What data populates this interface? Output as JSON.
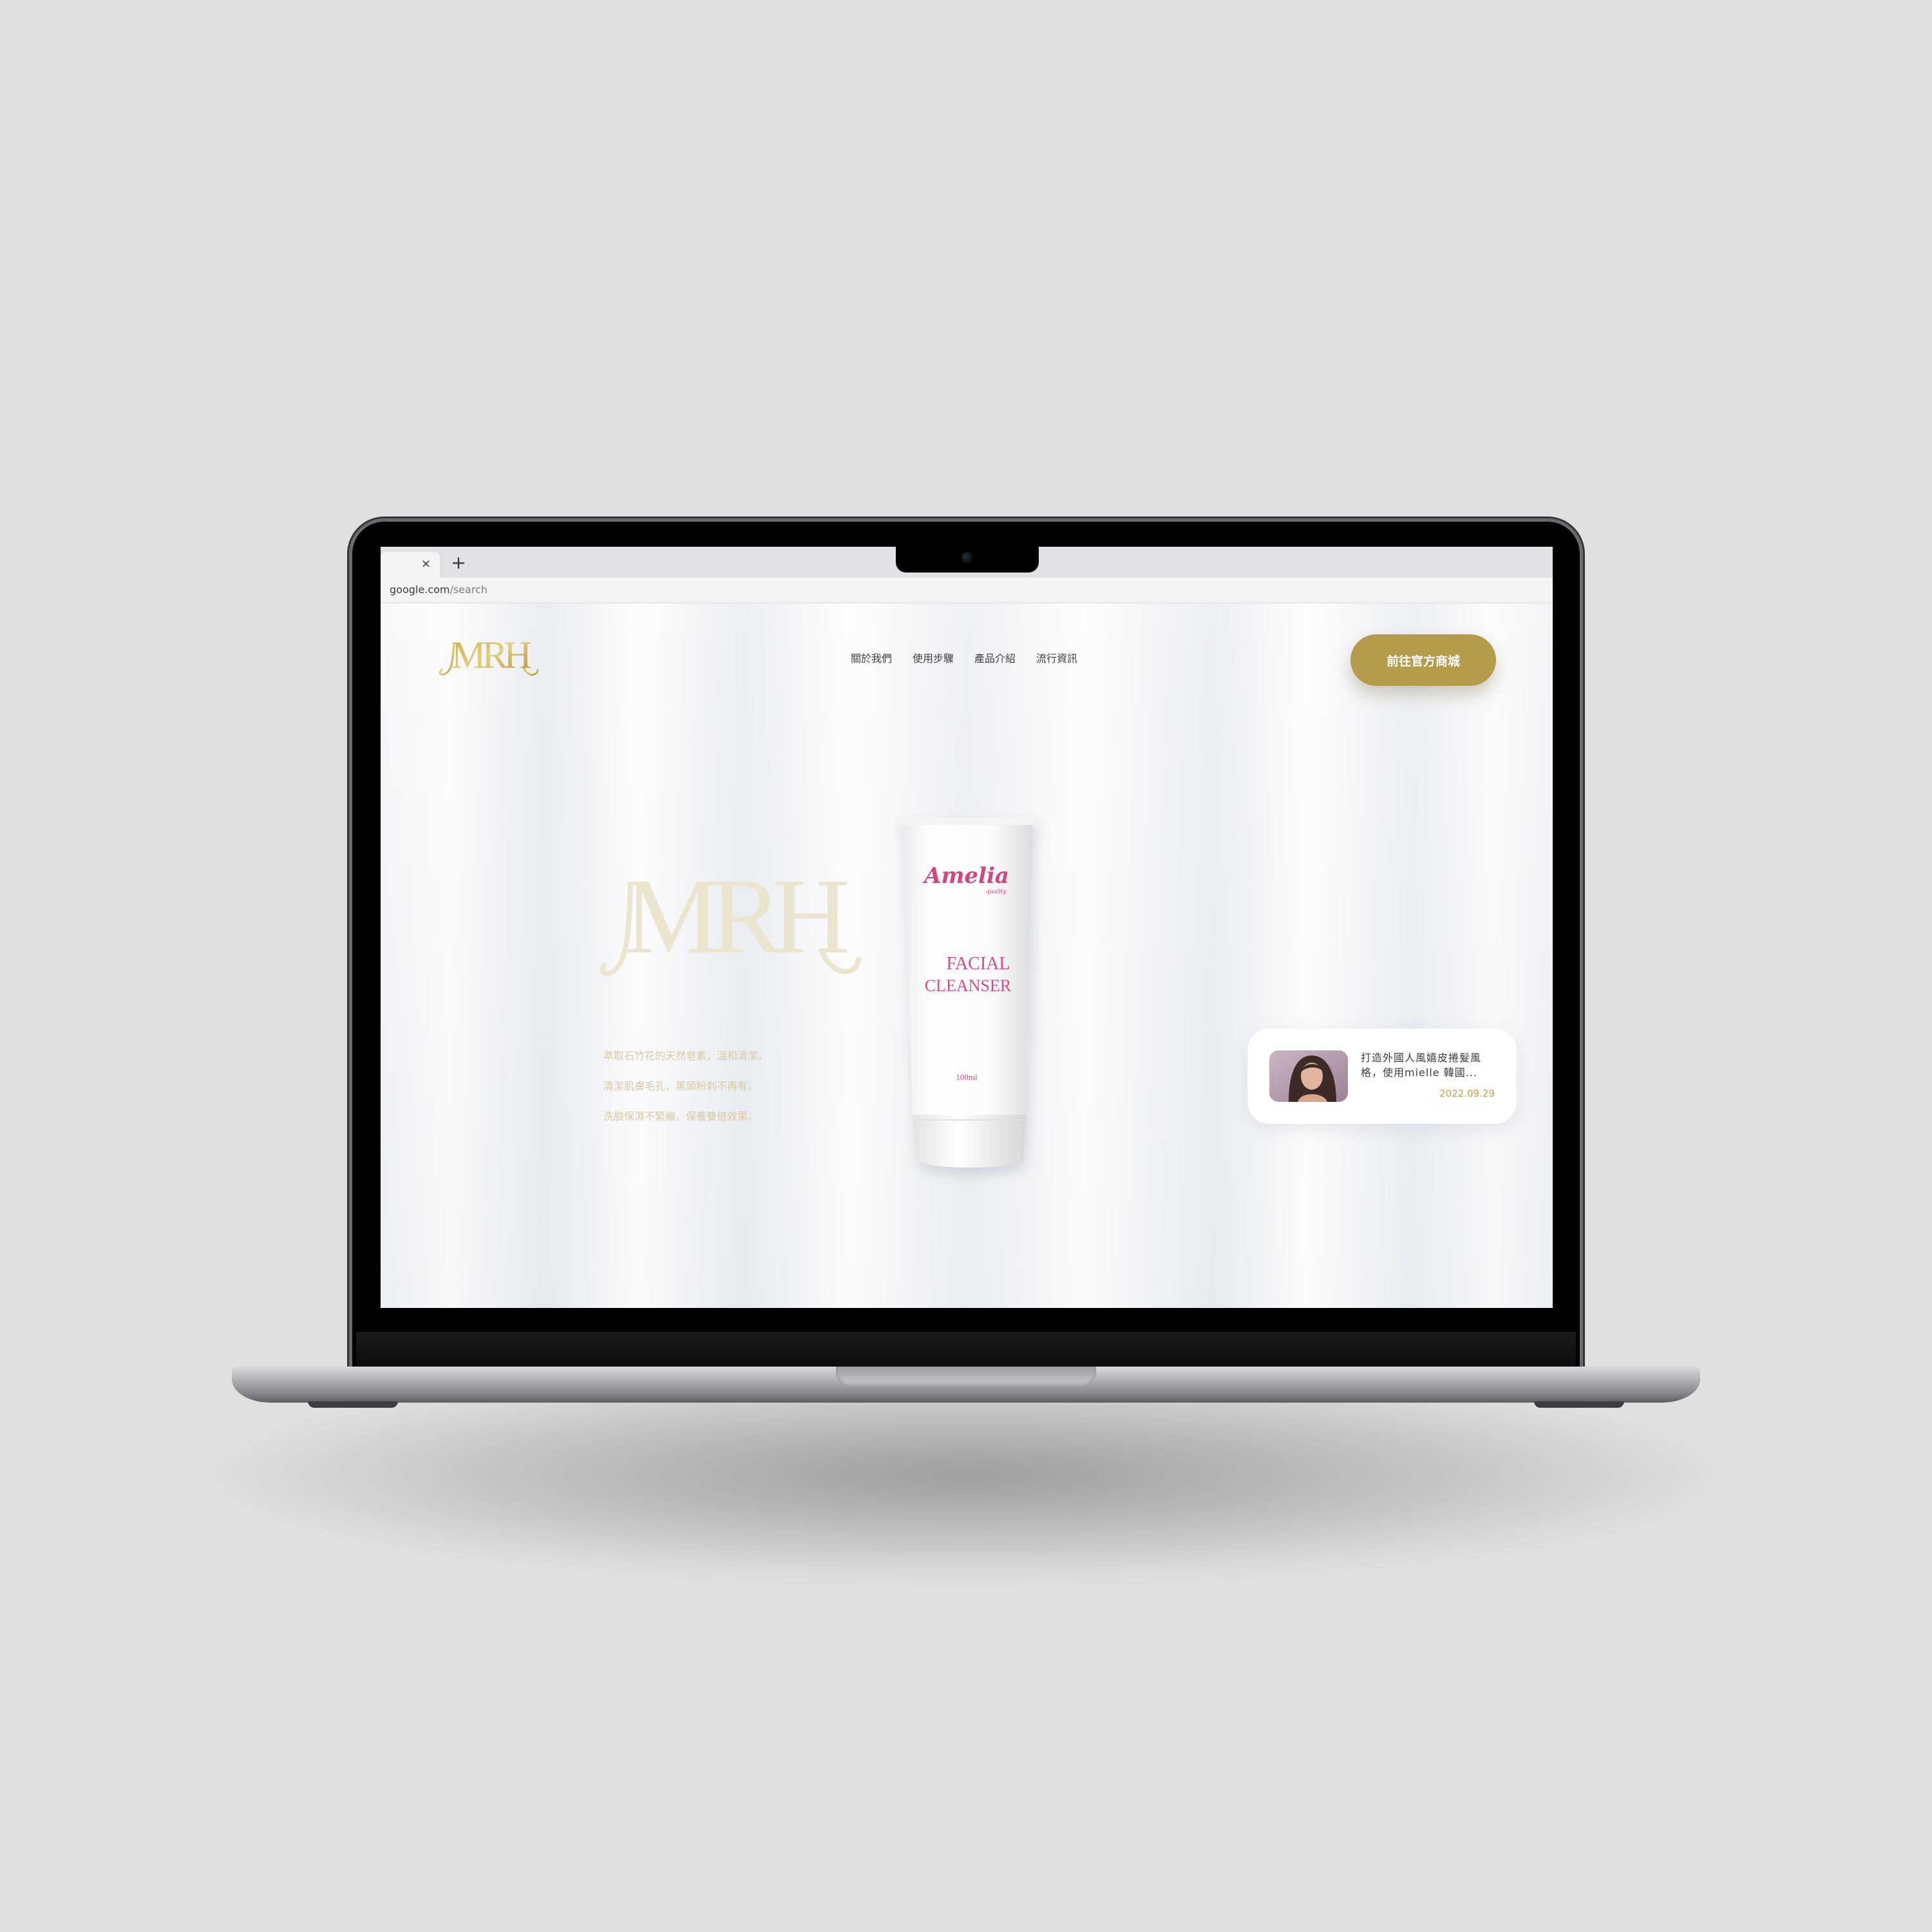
{
  "browser": {
    "tab_close": "×",
    "new_tab": "+",
    "url_host": "google.com",
    "url_path": "/search"
  },
  "site": {
    "logo_text": "MRH",
    "nav": [
      "關於我們",
      "使用步驟",
      "產品介紹",
      "流行資訊"
    ],
    "cta_label": "前往官方商城",
    "accent_color": "#b59c4d"
  },
  "hero": {
    "logo_text": "MRH",
    "taglines": [
      "萃取石竹花的天然皂素，溫和清潔。",
      "清潔肌膚毛孔，黑頭粉刺不再有。",
      "洗臉保濕不緊繃，保養雙倍效果。"
    ],
    "product": {
      "brand": "Amelia",
      "brand_sub": "quality",
      "name_line1": "FACIAL",
      "name_line2": "CLEANSER",
      "volume": "100ml"
    }
  },
  "news_card": {
    "text": "打造外國人風嬉皮捲髮風格，使用mielle 韓國...",
    "date": "2022.09.29",
    "thumb_icon": "woman-portrait-photo"
  }
}
